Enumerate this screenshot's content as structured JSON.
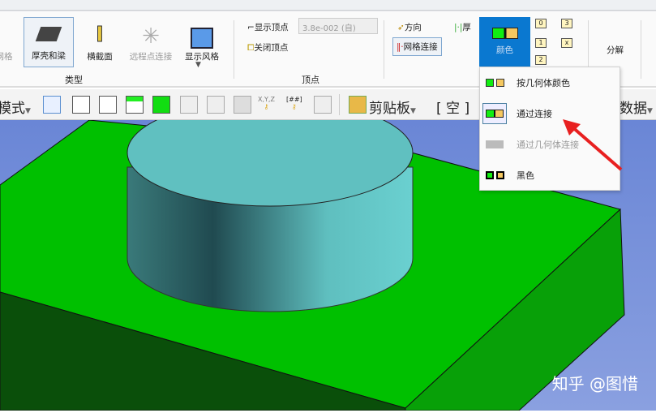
{
  "ribbon": {
    "type_group": {
      "label": "类型",
      "items": [
        {
          "label": "网格",
          "disabled": true
        },
        {
          "label": "厚壳和梁",
          "selected": true
        },
        {
          "label": "横截面"
        },
        {
          "label": "远程点连接",
          "disabled": true
        },
        {
          "label": "显示风格"
        }
      ]
    },
    "vertex_group": {
      "label": "顶点",
      "show_vertex": "显示顶点",
      "close_vertex": "关闭顶点",
      "value": "3.8e-002 (自)"
    },
    "mesh_group": {
      "direction": "方向",
      "thickness": "厚",
      "mesh_connection": "网格连接",
      "color": "颜色",
      "small_buttons": [
        "0",
        "3",
        "1",
        "x",
        "2"
      ],
      "explode": "分解"
    }
  },
  "toolbar": {
    "mode": "模式",
    "clipboard": "剪贴板",
    "empty": "[ 空 ]",
    "data": "数据"
  },
  "color_menu": {
    "items": [
      {
        "label": "按几何体颜色"
      },
      {
        "label": "通过连接",
        "selected": true
      },
      {
        "label": "通过几何体连接",
        "disabled": true
      },
      {
        "label": "黑色"
      }
    ]
  },
  "colors": {
    "accent": "#0a78d0",
    "green": "#00c000",
    "cylinder": "#60c0c0",
    "viewport": "#7b93d8"
  },
  "watermark": "知乎 @图惜"
}
